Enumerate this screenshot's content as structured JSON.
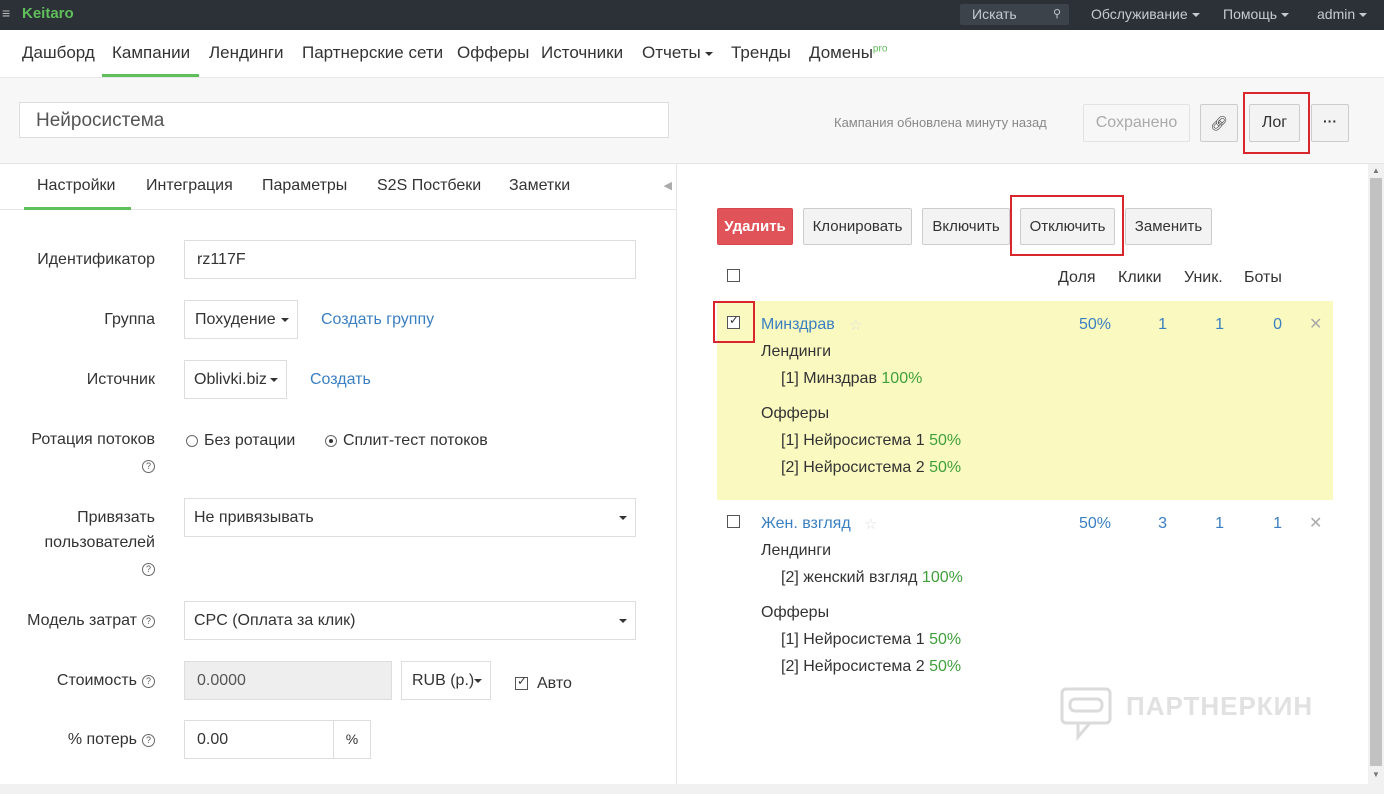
{
  "topbar": {
    "brand": "Keitaro",
    "search_label": "Искать",
    "menu": [
      "Обслуживание",
      "Помощь",
      "admin"
    ]
  },
  "nav": {
    "items": [
      "Дашборд",
      "Кампании",
      "Лендинги",
      "Партнерские сети",
      "Офферы",
      "Источники",
      "Отчеты",
      "Тренды",
      "Домены"
    ],
    "pro_badge": "pro"
  },
  "campaign": {
    "name": "Нейросистема",
    "updated": "Кампания обновлена минуту назад",
    "saved_label": "Сохранено",
    "log_label": "Лог",
    "more_label": "···"
  },
  "tabs": [
    "Настройки",
    "Интеграция",
    "Параметры",
    "S2S Постбеки",
    "Заметки"
  ],
  "form": {
    "id_label": "Идентификатор",
    "id_value": "rz117F",
    "group_label": "Группа",
    "group_value": "Похудение",
    "create_group": "Создать группу",
    "source_label": "Источник",
    "source_value": "Oblivki.biz",
    "create_source": "Создать",
    "rotation_label": "Ротация потоков",
    "rotation_options": [
      "Без ротации",
      "Сплит-тест потоков"
    ],
    "bind_label_1": "Привязать",
    "bind_label_2": "пользователей",
    "bind_value": "Не привязывать",
    "cost_model_label": "Модель затрат",
    "cost_model_value": "CPC (Оплата за клик)",
    "cost_label": "Стоимость",
    "cost_value": "0.0000",
    "currency": "RUB (р.)",
    "auto_label": "Авто",
    "loss_label": "% потерь",
    "loss_value": "0.00",
    "loss_unit": "%"
  },
  "actions": {
    "delete": "Удалить",
    "clone": "Клонировать",
    "enable": "Включить",
    "disable": "Отключить",
    "replace": "Заменить"
  },
  "columns": [
    "Доля",
    "Клики",
    "Уник.",
    "Боты"
  ],
  "streams": [
    {
      "name": "Минздрав",
      "share": "50%",
      "clicks": "1",
      "unique": "1",
      "bots": "0",
      "landings_label": "Лендинги",
      "landings": [
        {
          "text": "[1] Минздрав",
          "pct": "100%"
        }
      ],
      "offers_label": "Офферы",
      "offers": [
        {
          "text": "[1] Нейросистема 1",
          "pct": "50%"
        },
        {
          "text": "[2] Нейросистема 2",
          "pct": "50%"
        }
      ]
    },
    {
      "name": "Жен. взгляд",
      "share": "50%",
      "clicks": "3",
      "unique": "1",
      "bots": "1",
      "landings_label": "Лендинги",
      "landings": [
        {
          "text": "[2] женский взгляд",
          "pct": "100%"
        }
      ],
      "offers_label": "Офферы",
      "offers": [
        {
          "text": "[1] Нейросистема 1",
          "pct": "50%"
        },
        {
          "text": "[2] Нейросистема 2",
          "pct": "50%"
        }
      ]
    }
  ],
  "watermark": "ПАРТНЕРКИН",
  "colors": {
    "brand": "#5fbf5a",
    "link": "#3a7fc1",
    "danger": "#df5359",
    "highlight": "#fafac0",
    "annotation": "#d9262c"
  }
}
